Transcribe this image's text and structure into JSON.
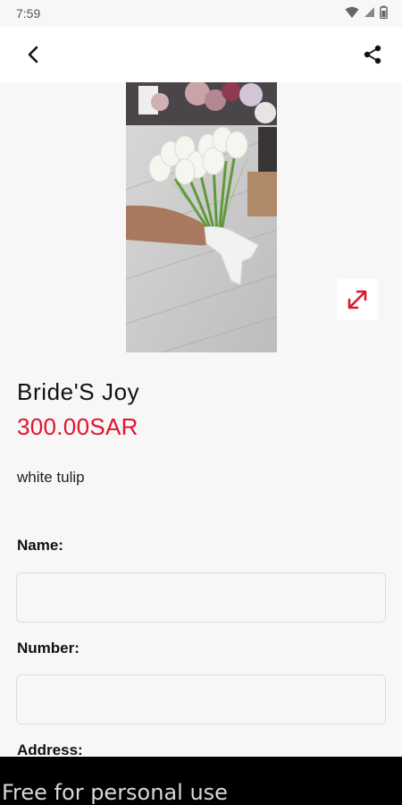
{
  "status_bar": {
    "time": "7:59",
    "icons": [
      "wifi-icon",
      "signal-icon",
      "battery-icon"
    ]
  },
  "app_bar": {
    "back_icon": "back-arrow-icon",
    "share_icon": "share-icon"
  },
  "product": {
    "image_alt": "bouquet of white tulips",
    "expand_icon": "expand-icon",
    "name": "Bride'S Joy",
    "price": "300.00SAR",
    "description": "white tulip"
  },
  "form": {
    "name_label": "Name:",
    "name_value": "",
    "number_label": "Number:",
    "number_value": "",
    "address_label": "Address:"
  },
  "watermark": "Free for personal use",
  "colors": {
    "accent_red": "#e0142b",
    "background": "#f7f7f7",
    "app_bar": "#ffffff"
  }
}
